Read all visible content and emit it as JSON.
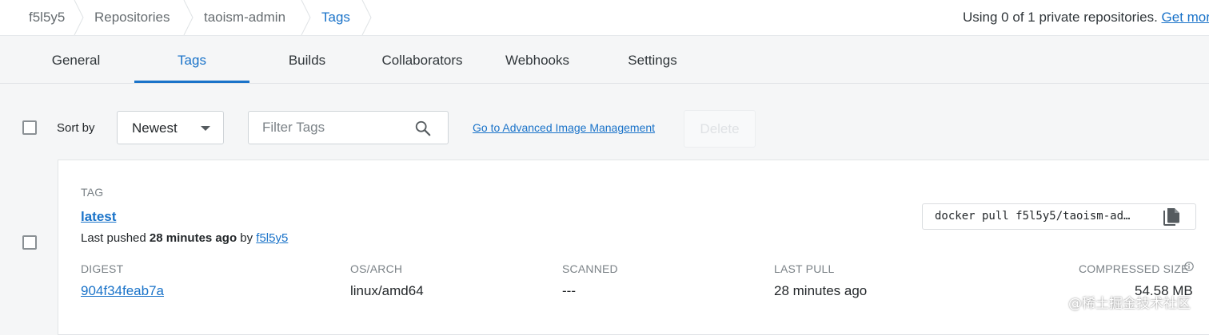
{
  "breadcrumb": {
    "items": [
      {
        "label": "f5l5y5"
      },
      {
        "label": "Repositories"
      },
      {
        "label": "taoism-admin"
      },
      {
        "label": "Tags"
      }
    ],
    "usage_text": "Using 0 of 1 private repositories. ",
    "usage_link": "Get more"
  },
  "tabs": [
    {
      "label": "General",
      "active": false
    },
    {
      "label": "Tags",
      "active": true
    },
    {
      "label": "Builds",
      "active": false
    },
    {
      "label": "Collaborators",
      "active": false
    },
    {
      "label": "Webhooks",
      "active": false
    },
    {
      "label": "Settings",
      "active": false
    }
  ],
  "toolbar": {
    "sort_label": "Sort by",
    "sort_value": "Newest",
    "filter_placeholder": "Filter Tags",
    "advanced_link": "Go to Advanced Image Management",
    "delete_label": "Delete"
  },
  "tag": {
    "header": "TAG",
    "name": "latest",
    "pushed_prefix": "Last pushed ",
    "pushed_time": "28 minutes ago",
    "pushed_by": " by ",
    "pushed_user": "f5l5y5",
    "pull_command": "docker pull f5l5y5/taoism-ad…",
    "columns": {
      "digest": "DIGEST",
      "os_arch": "OS/ARCH",
      "scanned": "SCANNED",
      "last_pull": "LAST PULL",
      "compressed_size": "COMPRESSED SIZE"
    },
    "values": {
      "digest": "904f34feab7a",
      "os_arch": "linux/amd64",
      "scanned": "---",
      "last_pull": "28 minutes ago",
      "compressed_size": "54.58 MB"
    }
  },
  "watermark": "@稀土掘金技术社区",
  "icons": {
    "search": "search-icon",
    "copy": "copy-icon",
    "info": "info-icon",
    "dropdown": "caret-down-icon"
  },
  "colors": {
    "accent": "#1a73c9",
    "background": "#f5f6f7"
  }
}
